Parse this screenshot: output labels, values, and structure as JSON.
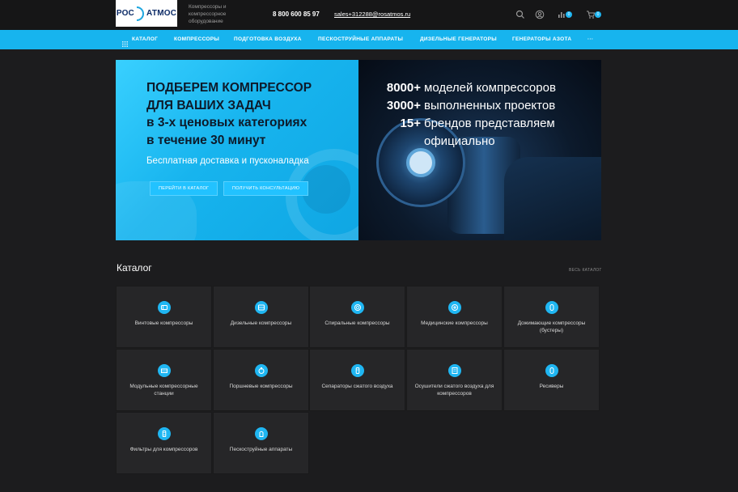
{
  "header": {
    "logo_left": "РОС",
    "logo_right": "АТМОС",
    "tagline": "Компрессоры и компрессорное оборудование",
    "phone": "8 800 600 85 97",
    "email": "sales+312288@rosatmos.ru",
    "compare_count": "0",
    "cart_count": "0"
  },
  "nav": {
    "items": [
      "КАТАЛОГ",
      "КОМПРЕССОРЫ",
      "ПОДГОТОВКА ВОЗДУХА",
      "ПЕСКОСТРУЙНЫЕ АППАРАТЫ",
      "ДИЗЕЛЬНЫЕ ГЕНЕРАТОРЫ",
      "ГЕНЕРАТОРЫ АЗОТА",
      "···"
    ]
  },
  "banner": {
    "title_lines": [
      "ПОДБЕРЕМ КОМПРЕССОР",
      "ДЛЯ ВАШИХ ЗАДАЧ",
      "в 3-х ценовых категориях",
      "в течение 30 минут"
    ],
    "subtitle": "Бесплатная доставка и пусконаладка",
    "button_catalog": "ПЕРЕЙТИ В КАТАЛОГ",
    "button_consult": "ПОЛУЧИТЬ КОНСУЛЬТАЦИЮ",
    "stats": [
      {
        "num": "8000+",
        "text": "моделей компрессоров"
      },
      {
        "num": "3000+",
        "text": "выполненных проектов"
      },
      {
        "num": "15+",
        "text": "брендов представляем"
      },
      {
        "num": "",
        "text": "официально"
      }
    ]
  },
  "catalog": {
    "title": "Каталог",
    "all_link": "ВЕСЬ КАТАЛОГ",
    "items": [
      {
        "label": "Винтовые компрессоры",
        "icon": "screw-compressor-icon"
      },
      {
        "label": "Дизельные компрессоры",
        "icon": "diesel-compressor-icon"
      },
      {
        "label": "Спиральные компрессоры",
        "icon": "scroll-compressor-icon"
      },
      {
        "label": "Медицинские компрессоры",
        "icon": "medical-compressor-icon"
      },
      {
        "label": "Дожимающие компрессоры (бустеры)",
        "icon": "booster-compressor-icon"
      },
      {
        "label": "Модульные компрессорные станции",
        "icon": "modular-station-icon"
      },
      {
        "label": "Поршневые компрессоры",
        "icon": "piston-compressor-icon"
      },
      {
        "label": "Сепараторы сжатого воздуха",
        "icon": "separator-icon"
      },
      {
        "label": "Осушители сжатого воздуха для компрессоров",
        "icon": "dryer-icon"
      },
      {
        "label": "Ресиверы",
        "icon": "receiver-icon"
      },
      {
        "label": "Фильтры для компрессоров",
        "icon": "filter-icon"
      },
      {
        "label": "Пескоструйные аппараты",
        "icon": "sandblaster-icon"
      }
    ]
  },
  "colors": {
    "accent": "#17b4ee",
    "background": "#1c1c1e",
    "card": "#262628",
    "header": "#161617"
  }
}
